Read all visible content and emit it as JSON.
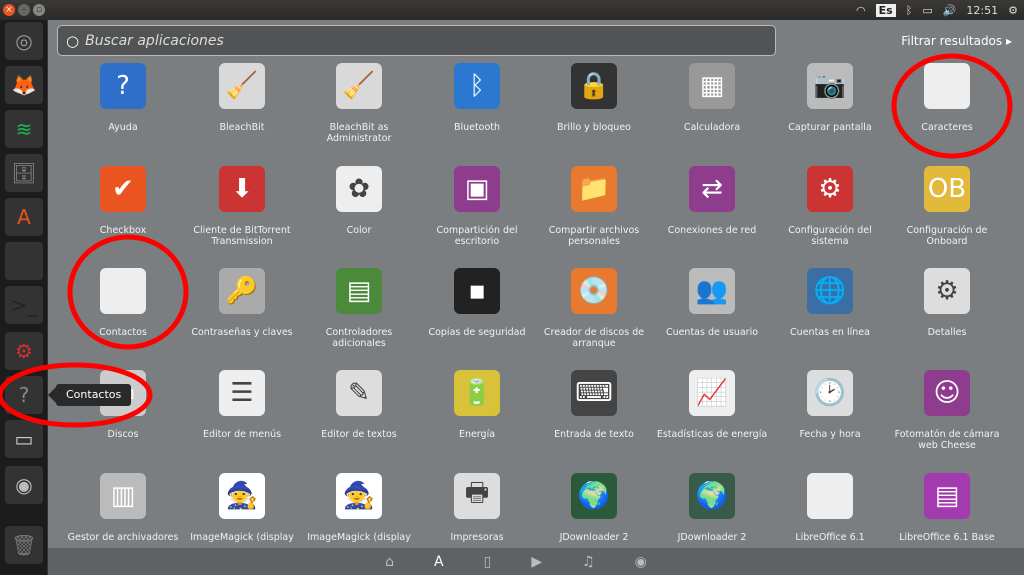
{
  "topbar": {
    "keyboard": "Es",
    "time": "12:51"
  },
  "search": {
    "placeholder": "Buscar aplicaciones"
  },
  "filter_label": "Filtrar resultados",
  "tooltip": "Contactos",
  "launcher": [
    {
      "name": "ubuntu-dash",
      "glyph": "◎",
      "color": "#9a9a9a"
    },
    {
      "name": "firefox",
      "glyph": "🦊",
      "color": "#e66000"
    },
    {
      "name": "spotify",
      "glyph": "≋",
      "color": "#1db954"
    },
    {
      "name": "files",
      "glyph": "🗄",
      "color": "#8a8a8a"
    },
    {
      "name": "software-center",
      "glyph": "A",
      "color": "#e95420"
    },
    {
      "name": "system-monitor",
      "glyph": "∿",
      "color": "#333"
    },
    {
      "name": "terminal",
      "glyph": ">_",
      "color": "#222"
    },
    {
      "name": "settings",
      "glyph": "⚙",
      "color": "#c33"
    },
    {
      "name": "contactos",
      "glyph": "?",
      "color": "#888"
    },
    {
      "name": "disk",
      "glyph": "▭",
      "color": "#ccc"
    },
    {
      "name": "disk-2",
      "glyph": "◉",
      "color": "#bbb"
    },
    {
      "name": "trash",
      "glyph": "🗑",
      "color": "#777"
    }
  ],
  "apps": [
    {
      "label": "Ayuda",
      "glyph": "?",
      "color": "#2f6fc9"
    },
    {
      "label": "BleachBit",
      "glyph": "🧹",
      "color": "#d9d9d9"
    },
    {
      "label": "BleachBit as Administrator",
      "glyph": "🧹",
      "color": "#d9d9d9"
    },
    {
      "label": "Bluetooth",
      "glyph": "ᛒ",
      "color": "#2b78d0"
    },
    {
      "label": "Brillo y bloqueo",
      "glyph": "🔒",
      "color": "#333"
    },
    {
      "label": "Calculadora",
      "glyph": "▦",
      "color": "#999"
    },
    {
      "label": "Capturar pantalla",
      "glyph": "📷",
      "color": "#bbb"
    },
    {
      "label": "Caracteres",
      "glyph": "",
      "color": "#eee"
    },
    {
      "label": "Checkbox",
      "glyph": "✔",
      "color": "#e95420"
    },
    {
      "label": "Cliente de BitTorrent Transmission",
      "glyph": "⬇",
      "color": "#c33"
    },
    {
      "label": "Color",
      "glyph": "✿",
      "color": "#eee"
    },
    {
      "label": "Compartición del escritorio",
      "glyph": "▣",
      "color": "#8e3d8e"
    },
    {
      "label": "Compartir archivos personales",
      "glyph": "📁",
      "color": "#e8792f"
    },
    {
      "label": "Conexiones de red",
      "glyph": "⇄",
      "color": "#8e3d8e"
    },
    {
      "label": "Configuración del sistema",
      "glyph": "⚙",
      "color": "#c33"
    },
    {
      "label": "Configuración de Onboard",
      "glyph": "OB",
      "color": "#e2b93b"
    },
    {
      "label": "Contactos",
      "glyph": "",
      "color": "#eee"
    },
    {
      "label": "Contraseñas y claves",
      "glyph": "🔑",
      "color": "#aaa"
    },
    {
      "label": "Controladores adicionales",
      "glyph": "▤",
      "color": "#4a8a3a"
    },
    {
      "label": "Copias de seguridad",
      "glyph": "▪",
      "color": "#222"
    },
    {
      "label": "Creador de discos de arranque",
      "glyph": "💿",
      "color": "#e8792f"
    },
    {
      "label": "Cuentas de usuario",
      "glyph": "👥",
      "color": "#bbb"
    },
    {
      "label": "Cuentas en línea",
      "glyph": "🌐",
      "color": "#3b6ea5"
    },
    {
      "label": "Detalles",
      "glyph": "⚙",
      "color": "#ddd"
    },
    {
      "label": "Discos",
      "glyph": "▭",
      "color": "#ccc"
    },
    {
      "label": "Editor de menús",
      "glyph": "☰",
      "color": "#eee"
    },
    {
      "label": "Editor de textos",
      "glyph": "✎",
      "color": "#ddd"
    },
    {
      "label": "Energía",
      "glyph": "🔋",
      "color": "#d8c23a"
    },
    {
      "label": "Entrada de texto",
      "glyph": "⌨",
      "color": "#444"
    },
    {
      "label": "Estadísticas de energía",
      "glyph": "📈",
      "color": "#eee"
    },
    {
      "label": "Fecha y hora",
      "glyph": "🕑",
      "color": "#ddd"
    },
    {
      "label": "Fotomatón de cámara web Cheese",
      "glyph": "☺",
      "color": "#8e3d8e"
    },
    {
      "label": "Gestor de archivadores",
      "glyph": "▥",
      "color": "#bbb"
    },
    {
      "label": "ImageMagick (display",
      "glyph": "🧙",
      "color": "#fff"
    },
    {
      "label": "ImageMagick (display",
      "glyph": "🧙",
      "color": "#fff"
    },
    {
      "label": "Impresoras",
      "glyph": "🖶",
      "color": "#ddd"
    },
    {
      "label": "JDownloader 2",
      "glyph": "🌍",
      "color": "#2a5a3a"
    },
    {
      "label": "JDownloader 2",
      "glyph": "🌍",
      "color": "#3a5a4a"
    },
    {
      "label": "LibreOffice 6.1",
      "glyph": "",
      "color": "#eee"
    },
    {
      "label": "LibreOffice 6.1 Base",
      "glyph": "▤",
      "color": "#a33ab0"
    }
  ],
  "bottom_lenses": [
    {
      "name": "home",
      "glyph": "⌂"
    },
    {
      "name": "applications",
      "glyph": "A"
    },
    {
      "name": "files",
      "glyph": "▯"
    },
    {
      "name": "video",
      "glyph": "▶"
    },
    {
      "name": "music",
      "glyph": "♫"
    },
    {
      "name": "photos",
      "glyph": "◉"
    }
  ],
  "annotation_color": "#ff0000"
}
